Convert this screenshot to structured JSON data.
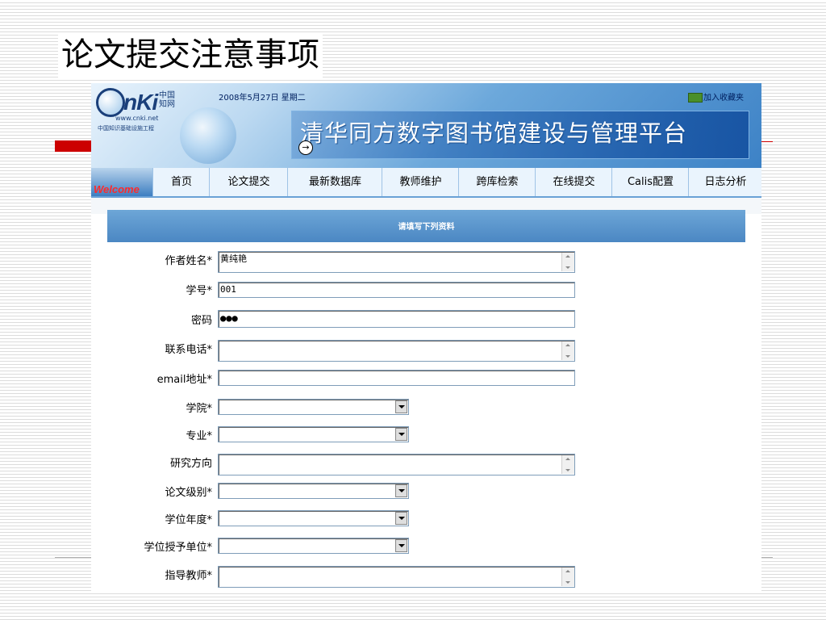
{
  "slide": {
    "title": "论文提交注意事项"
  },
  "header": {
    "logo_brand": "nKi",
    "logo_cn": "中国 知网",
    "logo_url": "www.cnki.net",
    "logo_sub": "中国知识基础设施工程",
    "date": "2008年5月27日 星期二",
    "favorite": "加入收藏夹",
    "title": "清华同方数字图书馆建设与管理平台",
    "arrow": "→"
  },
  "nav": {
    "welcome": "Welcome",
    "items": [
      "首页",
      "论文提交",
      "最新数据库",
      "教师维护",
      "跨库检索",
      "在线提交",
      "Calis配置",
      "日志分析"
    ]
  },
  "form": {
    "heading": "请填写下列资料",
    "fields": [
      {
        "label": "作者姓名*",
        "value": "黄纯艳"
      },
      {
        "label": "学号*",
        "value": "001"
      },
      {
        "label": "密码",
        "value": "●●●"
      },
      {
        "label": "联系电话*",
        "value": ""
      },
      {
        "label": "email地址*",
        "value": ""
      },
      {
        "label": "学院*",
        "value": ""
      },
      {
        "label": "专业*",
        "value": ""
      },
      {
        "label": "研究方向",
        "value": ""
      },
      {
        "label": "论文级别*",
        "value": ""
      },
      {
        "label": "学位年度*",
        "value": ""
      },
      {
        "label": "学位授予单位*",
        "value": ""
      },
      {
        "label": "指导教师*",
        "value": ""
      }
    ]
  },
  "colors": {
    "accent": "#cc0000",
    "nav_border": "#6aa1d6",
    "panel_head": "#5a96cd"
  }
}
